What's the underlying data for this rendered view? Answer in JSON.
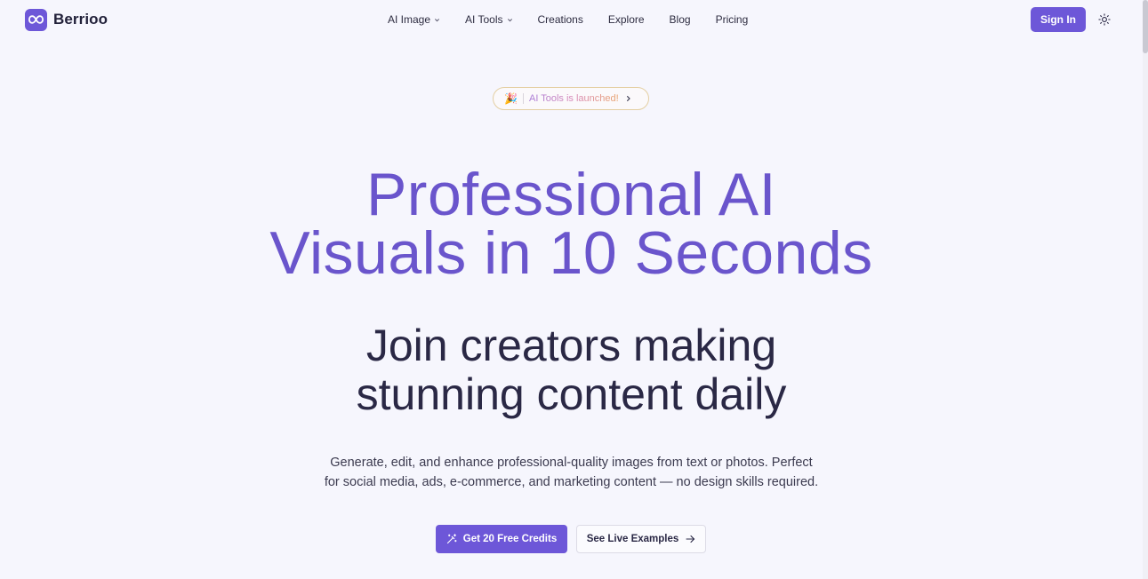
{
  "header": {
    "logo_text": "Berrioo",
    "nav": [
      {
        "label": "AI Image",
        "has_dropdown": true
      },
      {
        "label": "AI Tools",
        "has_dropdown": true
      },
      {
        "label": "Creations",
        "has_dropdown": false
      },
      {
        "label": "Explore",
        "has_dropdown": false
      },
      {
        "label": "Blog",
        "has_dropdown": false
      },
      {
        "label": "Pricing",
        "has_dropdown": false
      }
    ],
    "sign_in_label": "Sign In",
    "theme_icon": "sun-icon"
  },
  "announcement": {
    "emoji": "🎉",
    "text": "AI Tools is launched!"
  },
  "hero": {
    "title_line1": "Professional AI",
    "title_line2": "Visuals in 10 Seconds",
    "subtitle_line1": "Join creators making",
    "subtitle_line2": "stunning content daily",
    "desc_line1": "Generate, edit, and enhance professional-quality images from text or photos. Perfect",
    "desc_line2": "for social media, ads, e-commerce, and marketing content — no design skills required."
  },
  "cta": {
    "primary_label": "Get 20 Free Credits",
    "primary_icon": "magic-wand-icon",
    "secondary_label": "See Live Examples",
    "secondary_icon": "arrow-right-icon"
  },
  "colors": {
    "brand": "#6d57d8",
    "title": "#6a55cc",
    "background": "#f6f6fd",
    "text_dark": "#2a2845"
  }
}
